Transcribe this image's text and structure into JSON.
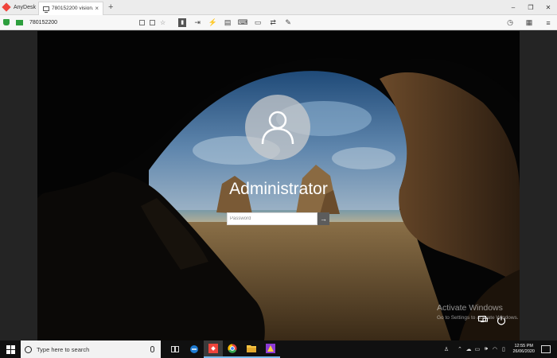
{
  "anydesk": {
    "brand": "AnyDesk",
    "tab_title": "780152200 vision...",
    "tab_close": "×",
    "tab_new": "+",
    "window_controls": [
      "–",
      "❐",
      "✕"
    ],
    "address": "780152200",
    "toolbar_icons": [
      "display-icon",
      "file-transfer-icon",
      "lightning-icon",
      "chat-icon",
      "keyboard-icon",
      "monitor-icon",
      "switch-sides-icon",
      "whiteboard-pen-icon"
    ],
    "right_icons": [
      "history-icon",
      "menu-doc-icon",
      "hamburger-icon"
    ],
    "colors": {
      "brand": "#ef443b",
      "secure": "#2e9f3e"
    }
  },
  "login": {
    "username": "Administrator",
    "password_placeholder": "Password",
    "submit_glyph": "→"
  },
  "watermark": {
    "title": "Activate Windows",
    "subtitle": "Go to Settings to activate Windows."
  },
  "taskbar": {
    "search_placeholder": "Type here to search",
    "apps": [
      "task-view-icon",
      "edge-icon",
      "anydesk-app-icon",
      "chrome-icon",
      "file-explorer-icon",
      "media-app-icon"
    ],
    "time": "12:55 PM",
    "date": "26/06/2020"
  }
}
